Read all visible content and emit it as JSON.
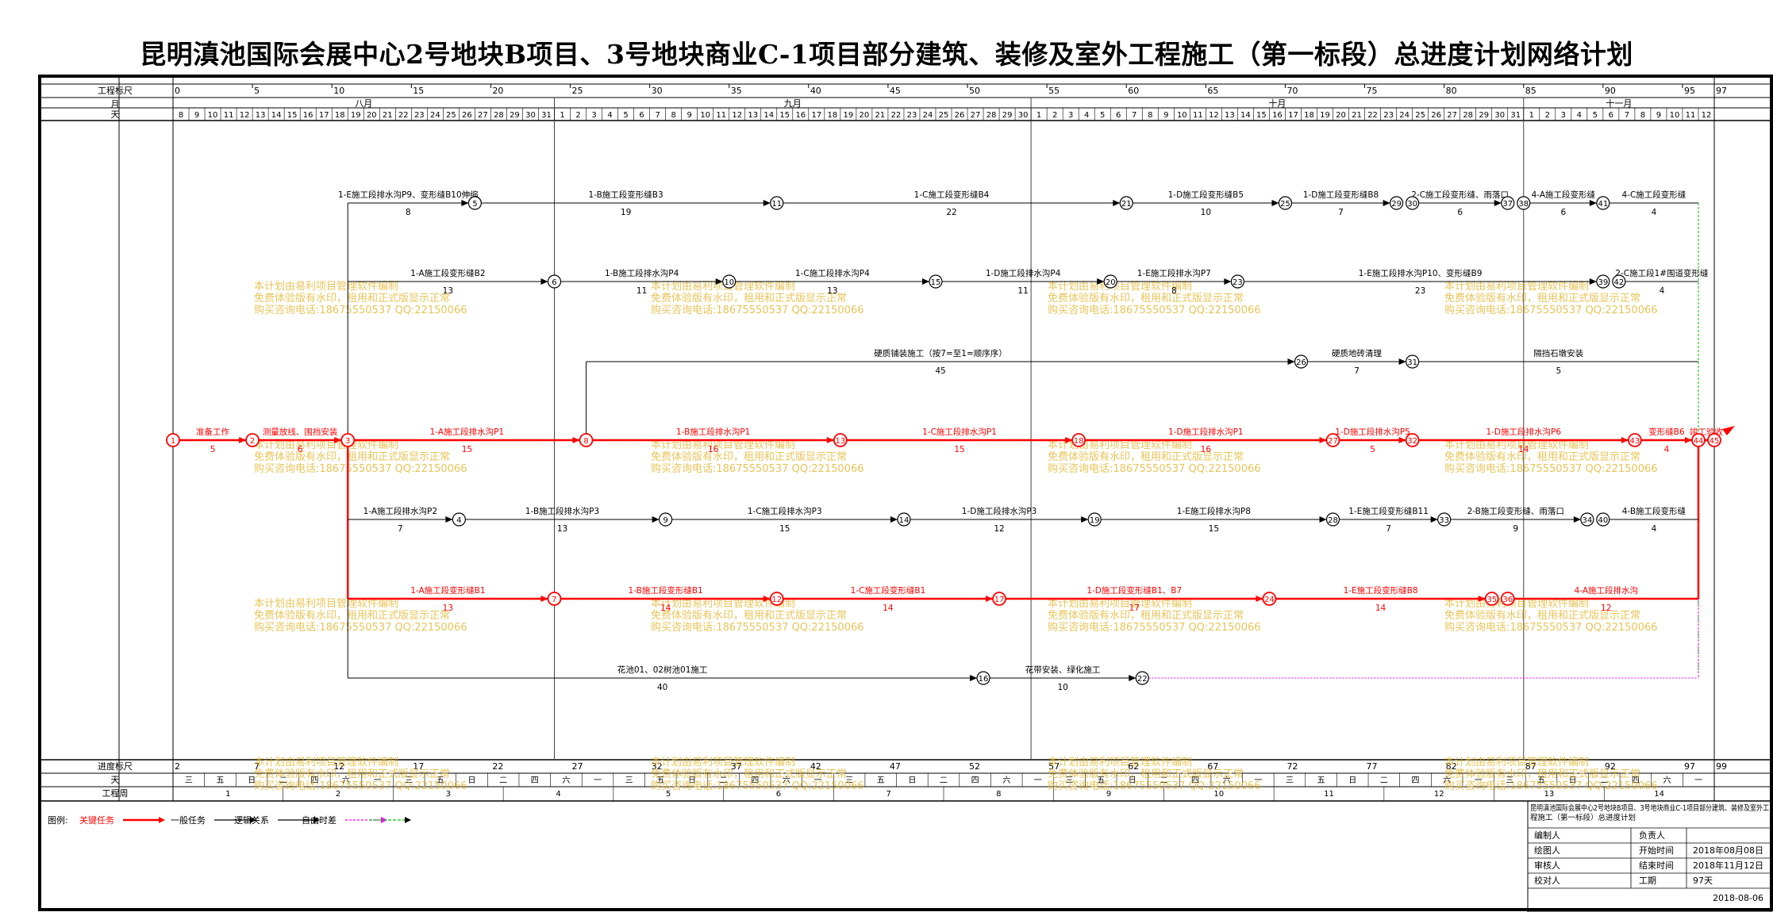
{
  "title": "昆明滇池国际会展中心2号地块B项目、3号地块商业C-1项目部分建筑、装修及室外工程施工（第一标段）总进度计划网络计划",
  "header": {
    "row_labels": [
      "工程标尺",
      "月",
      "天"
    ],
    "scale_ticks": [
      "0",
      "5",
      "10",
      "15",
      "20",
      "25",
      "30",
      "35",
      "40",
      "45",
      "50",
      "55",
      "60",
      "65",
      "70",
      "75",
      "80",
      "85",
      "90",
      "95",
      "97"
    ],
    "months": [
      "八月",
      "九月",
      "十月",
      "十一月"
    ],
    "days": [
      "8",
      "9",
      "10",
      "11",
      "12",
      "13",
      "14",
      "15",
      "16",
      "17",
      "18",
      "19",
      "20",
      "21",
      "22",
      "23",
      "24",
      "25",
      "26",
      "27",
      "28",
      "29",
      "30",
      "31",
      "1",
      "2",
      "3",
      "4",
      "5",
      "6",
      "7",
      "8",
      "9",
      "10",
      "11",
      "12",
      "13",
      "14",
      "15",
      "16",
      "17",
      "18",
      "19",
      "20",
      "21",
      "22",
      "23",
      "24",
      "25",
      "26",
      "27",
      "28",
      "29",
      "30",
      "1",
      "2",
      "3",
      "4",
      "5",
      "6",
      "7",
      "8",
      "9",
      "10",
      "11",
      "12",
      "13",
      "14",
      "15",
      "16",
      "17",
      "18",
      "19",
      "20",
      "21",
      "22",
      "23",
      "24",
      "25",
      "26",
      "27",
      "28",
      "29",
      "30",
      "31",
      "1",
      "2",
      "3",
      "4",
      "5",
      "6",
      "7",
      "8",
      "9",
      "10",
      "11",
      "12"
    ]
  },
  "footer": {
    "row_labels": [
      "进度标尺",
      "天",
      "工程周"
    ],
    "progress_ticks": [
      "2",
      "7",
      "12",
      "17",
      "22",
      "27",
      "32",
      "37",
      "42",
      "47",
      "52",
      "57",
      "62",
      "67",
      "72",
      "77",
      "82",
      "87",
      "92",
      "97",
      "99"
    ],
    "weekdays": [
      "三",
      "五",
      "日",
      "二",
      "四",
      "六",
      "一",
      "三",
      "五",
      "日",
      "二",
      "四",
      "六",
      "一",
      "三",
      "五",
      "日",
      "二",
      "四",
      "六",
      "一",
      "三",
      "五",
      "日",
      "二",
      "四",
      "六",
      "一",
      "三",
      "五",
      "日",
      "二",
      "四",
      "六",
      "一",
      "三",
      "五",
      "日",
      "二",
      "四",
      "六",
      "一",
      "三",
      "五",
      "日",
      "二",
      "四",
      "六",
      "一"
    ],
    "weeks": [
      "1",
      "2",
      "3",
      "4",
      "5",
      "6",
      "7",
      "8",
      "9",
      "10",
      "11",
      "12",
      "13",
      "14"
    ]
  },
  "nodes": [
    {
      "id": "1",
      "day": 0,
      "row": 4,
      "crit": true
    },
    {
      "id": "2",
      "day": 5,
      "row": 4,
      "crit": true
    },
    {
      "id": "3",
      "day": 11,
      "row": 4,
      "crit": true
    },
    {
      "id": "5",
      "day": 19,
      "row": 0
    },
    {
      "id": "11",
      "day": 38,
      "row": 0
    },
    {
      "id": "21",
      "day": 60,
      "row": 0
    },
    {
      "id": "25",
      "day": 70,
      "row": 0
    },
    {
      "id": "29",
      "day": 77,
      "row": 0
    },
    {
      "id": "30",
      "day": 78,
      "row": 0
    },
    {
      "id": "37",
      "day": 84,
      "row": 0
    },
    {
      "id": "38",
      "day": 85,
      "row": 0
    },
    {
      "id": "41",
      "day": 90,
      "row": 0
    },
    {
      "id": "6",
      "day": 24,
      "row": 1
    },
    {
      "id": "10",
      "day": 35,
      "row": 1
    },
    {
      "id": "15",
      "day": 48,
      "row": 1
    },
    {
      "id": "20",
      "day": 59,
      "row": 1
    },
    {
      "id": "23",
      "day": 67,
      "row": 1
    },
    {
      "id": "39",
      "day": 90,
      "row": 1
    },
    {
      "id": "42",
      "day": 91,
      "row": 1
    },
    {
      "id": "26",
      "day": 71,
      "row": 2
    },
    {
      "id": "31",
      "day": 78,
      "row": 2
    },
    {
      "id": "8",
      "day": 26,
      "row": 4,
      "crit": true
    },
    {
      "id": "13",
      "day": 42,
      "row": 4,
      "crit": true
    },
    {
      "id": "18",
      "day": 57,
      "row": 4,
      "crit": true
    },
    {
      "id": "27",
      "day": 73,
      "row": 4,
      "crit": true
    },
    {
      "id": "32",
      "day": 78,
      "row": 4,
      "crit": true
    },
    {
      "id": "43",
      "day": 92,
      "row": 4,
      "crit": true
    },
    {
      "id": "44",
      "day": 96,
      "row": 4,
      "crit": true
    },
    {
      "id": "45",
      "day": 97,
      "row": 4,
      "crit": true
    },
    {
      "id": "4",
      "day": 18,
      "row": 5
    },
    {
      "id": "9",
      "day": 31,
      "row": 5
    },
    {
      "id": "14",
      "day": 46,
      "row": 5
    },
    {
      "id": "19",
      "day": 58,
      "row": 5
    },
    {
      "id": "28",
      "day": 73,
      "row": 5
    },
    {
      "id": "33",
      "day": 80,
      "row": 5
    },
    {
      "id": "34",
      "day": 89,
      "row": 5
    },
    {
      "id": "40",
      "day": 90,
      "row": 5
    },
    {
      "id": "7",
      "day": 24,
      "row": 6,
      "crit": true
    },
    {
      "id": "12",
      "day": 38,
      "row": 6,
      "crit": true
    },
    {
      "id": "17",
      "day": 52,
      "row": 6,
      "crit": true
    },
    {
      "id": "24",
      "day": 69,
      "row": 6,
      "crit": true
    },
    {
      "id": "35",
      "day": 83,
      "row": 6,
      "crit": true
    },
    {
      "id": "36",
      "day": 84,
      "row": 6,
      "crit": true
    },
    {
      "id": "16",
      "day": 51,
      "row": 7
    },
    {
      "id": "22",
      "day": 61,
      "row": 7
    }
  ],
  "activities": [
    {
      "from": "1",
      "to": "2",
      "name": "准备工作",
      "dur": "5",
      "crit": true
    },
    {
      "from": "2",
      "to": "3",
      "name": "测量放线、围挡安装",
      "dur": "6",
      "crit": true
    },
    {
      "from": "3",
      "to": "8",
      "name": "1-A施工段排水沟P1",
      "dur": "15",
      "crit": true
    },
    {
      "from": "8",
      "to": "13",
      "name": "1-B施工段排水沟P1",
      "dur": "16",
      "crit": true
    },
    {
      "from": "13",
      "to": "18",
      "name": "1-C施工段排水沟P1",
      "dur": "15",
      "crit": true
    },
    {
      "from": "18",
      "to": "27",
      "name": "1-D施工段排水沟P1",
      "dur": "16",
      "crit": true
    },
    {
      "from": "27",
      "to": "32",
      "name": "1-D施工段排水沟P5",
      "dur": "5",
      "crit": true
    },
    {
      "from": "32",
      "to": "43",
      "name": "1-D施工段排水沟P6",
      "dur": "14",
      "crit": true
    },
    {
      "from": "43",
      "to": "44",
      "name": "变形缝B6",
      "dur": "4",
      "crit": true
    },
    {
      "from": "44",
      "to": "45",
      "name": "竣工验收",
      "dur": "",
      "crit": true
    },
    {
      "from": "3",
      "to": "5",
      "name": "1-E施工段排水沟P9、变形缝B10伸缩",
      "dur": "8",
      "row_from": 0
    },
    {
      "from": "5",
      "to": "11",
      "name": "1-B施工段变形缝B3",
      "dur": "19"
    },
    {
      "from": "11",
      "to": "21",
      "name": "1-C施工段变形缝B4",
      "dur": "22"
    },
    {
      "from": "21",
      "to": "25",
      "name": "1-D施工段变形缝B5",
      "dur": "10"
    },
    {
      "from": "25",
      "to": "29",
      "name": "1-D施工段变形缝B8",
      "dur": "7"
    },
    {
      "from": "30",
      "to": "37",
      "name": "2-C施工段变形缝、雨落口",
      "dur": "6"
    },
    {
      "from": "38",
      "to": "41",
      "name": "4-A施工段变形缝",
      "dur": "6"
    },
    {
      "from": "41",
      "to": "end",
      "name": "4-C施工段变形缝",
      "dur": "4"
    },
    {
      "from": "3",
      "to": "6",
      "name": "1-A施工段变形缝B2",
      "dur": "13",
      "row_from": 1
    },
    {
      "from": "6",
      "to": "10",
      "name": "1-B施工段排水沟P4",
      "dur": "11"
    },
    {
      "from": "10",
      "to": "15",
      "name": "1-C施工段排水沟P4",
      "dur": "13"
    },
    {
      "from": "15",
      "to": "20",
      "name": "1-D施工段排水沟P4",
      "dur": "11"
    },
    {
      "from": "20",
      "to": "23",
      "name": "1-E施工段排水沟P7",
      "dur": "8"
    },
    {
      "from": "23",
      "to": "39",
      "name": "1-E施工段排水沟P10、变形缝B9",
      "dur": "23"
    },
    {
      "from": "42",
      "to": "end",
      "name": "2-C施工段1#围道变形缝",
      "dur": "4"
    },
    {
      "from": "8",
      "to": "26",
      "name": "硬质铺装施工（按7=至1=顺序序）",
      "dur": "45",
      "row_from": 2
    },
    {
      "from": "26",
      "to": "31",
      "name": "硬质地砖清理",
      "dur": "7"
    },
    {
      "from": "31",
      "to": "end",
      "name": "隔挡石墩安装",
      "dur": "5"
    },
    {
      "from": "3",
      "to": "4",
      "name": "1-A施工段排水沟P2",
      "dur": "7",
      "row_from": 5
    },
    {
      "from": "4",
      "to": "9",
      "name": "1-B施工段排水沟P3",
      "dur": "13"
    },
    {
      "from": "9",
      "to": "14",
      "name": "1-C施工段排水沟P3",
      "dur": "15"
    },
    {
      "from": "14",
      "to": "19",
      "name": "1-D施工段排水沟P3",
      "dur": "12"
    },
    {
      "from": "19",
      "to": "28",
      "name": "1-E施工段排水沟P8",
      "dur": "15"
    },
    {
      "from": "28",
      "to": "33",
      "name": "1-E施工段变形缝B11",
      "dur": "7"
    },
    {
      "from": "33",
      "to": "34",
      "name": "2-B施工段变形缝、雨落口",
      "dur": "9"
    },
    {
      "from": "40",
      "to": "end",
      "name": "4-B施工段变形缝",
      "dur": "4"
    },
    {
      "from": "3",
      "to": "7",
      "name": "1-A施工段变形缝B1",
      "dur": "13",
      "crit": true,
      "row_from": 6
    },
    {
      "from": "7",
      "to": "12",
      "name": "1-B施工段变形缝B1",
      "dur": "14",
      "crit": true
    },
    {
      "from": "12",
      "to": "17",
      "name": "1-C施工段变形缝B1",
      "dur": "14",
      "crit": true
    },
    {
      "from": "17",
      "to": "24",
      "name": "1-D施工段变形缝B1、B7",
      "dur": "17",
      "crit": true
    },
    {
      "from": "24",
      "to": "35",
      "name": "1-E施工段变形缝B8",
      "dur": "14",
      "crit": true
    },
    {
      "from": "36",
      "to": "end",
      "name": "4-A施工段排水沟",
      "dur": "12",
      "crit": true
    },
    {
      "from": "3",
      "to": "16",
      "name": "花池01、02树池01施工",
      "dur": "40",
      "row_from": 7
    },
    {
      "from": "16",
      "to": "22",
      "name": "花带安装、绿化施工",
      "dur": "10"
    }
  ],
  "watermark": [
    "本计划由易利项目管理软件编制",
    "免费体验版有水印，租用和正式版显示正常",
    "购买咨询电话:18675550537 QQ:22150066"
  ],
  "legend": {
    "label": "图例:",
    "items": [
      {
        "label": "关键任务",
        "color": "#ff0000"
      },
      {
        "label": "一般任务",
        "color": "#000000"
      },
      {
        "label": "逻辑关系",
        "color": "#000000"
      },
      {
        "label": "自由时差",
        "color": "#ff00ff"
      },
      {
        "label": "",
        "color": "#00c000"
      }
    ]
  },
  "info_table": {
    "title": "昆明滇池国际会展中心2号地块B项目、3号地块商业C-1项目部分建筑、装修及室外工程施工（第一标段）总进度计划",
    "rows": [
      {
        "left": "编制人",
        "mid": "负责人",
        "right": ""
      },
      {
        "left": "绘图人",
        "mid": "开始时间",
        "right": "2018年08月08日"
      },
      {
        "left": "审核人",
        "mid": "结束时间",
        "right": "2018年11月12日"
      },
      {
        "left": "校对人",
        "mid": "工期",
        "right": "97天"
      }
    ],
    "date": "2018-08-06"
  },
  "colors": {
    "critical": "#ff0000",
    "normal": "#000000",
    "float": "#ff00ff",
    "green": "#00c000",
    "watermark": "#e0b020"
  }
}
